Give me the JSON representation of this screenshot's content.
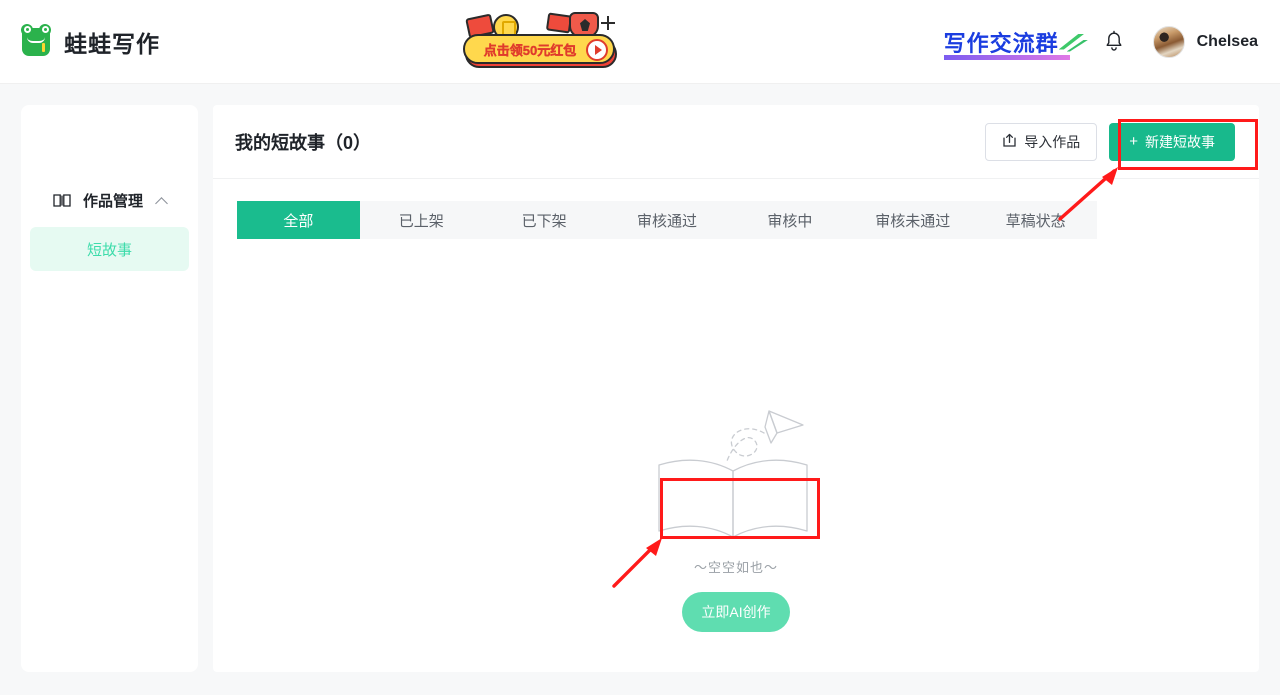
{
  "header": {
    "brand_name": "蛙蛙写作",
    "brand_icon": "frog-logo-icon",
    "promo": {
      "label": "点击领50元红包",
      "play_icon": "play-icon"
    },
    "group_link": {
      "label": "写作交流群",
      "check_icon": "green-check-icon"
    },
    "bell_icon": "bell-icon",
    "avatar_alt": "avatar",
    "user_name": "Chelsea"
  },
  "sidebar": {
    "group": {
      "label": "作品管理",
      "icon": "book-icon",
      "chevron": "chevron-up-icon"
    },
    "items": [
      {
        "label": "短故事",
        "active": true
      }
    ]
  },
  "main": {
    "page_title": "我的短故事（0）",
    "count": 0,
    "actions": {
      "import_label": "导入作品",
      "import_icon": "upload-icon",
      "new_label": "新建短故事",
      "new_icon": "plus-icon"
    },
    "tabs": [
      {
        "label": "全部",
        "active": true
      },
      {
        "label": "已上架",
        "active": false
      },
      {
        "label": "已下架",
        "active": false
      },
      {
        "label": "审核通过",
        "active": false
      },
      {
        "label": "审核中",
        "active": false
      },
      {
        "label": "审核未通过",
        "active": false
      },
      {
        "label": "草稿状态",
        "active": false
      }
    ],
    "empty_state": {
      "illustration": "open-book-paper-plane-icon",
      "text": "～空空如也～",
      "cta_label": "立即AI创作"
    },
    "rows": []
  },
  "annotations": {
    "highlight_color": "#ff1a1a",
    "boxes": [
      {
        "name": "new-story-button-highlight"
      },
      {
        "name": "ai-create-button-highlight"
      }
    ],
    "arrows": [
      {
        "name": "arrow-to-new-story-button"
      },
      {
        "name": "arrow-to-ai-create-button"
      }
    ]
  },
  "theme": {
    "accent_green": "#18b98c",
    "tab_active_green": "#1abc8e",
    "soft_green": "#5fddb0",
    "sidebar_active_bg": "#e6faf2",
    "sidebar_active_text": "#3ddcab",
    "brand_blue": "#1b3de0",
    "page_bg": "#f7f8f9"
  }
}
